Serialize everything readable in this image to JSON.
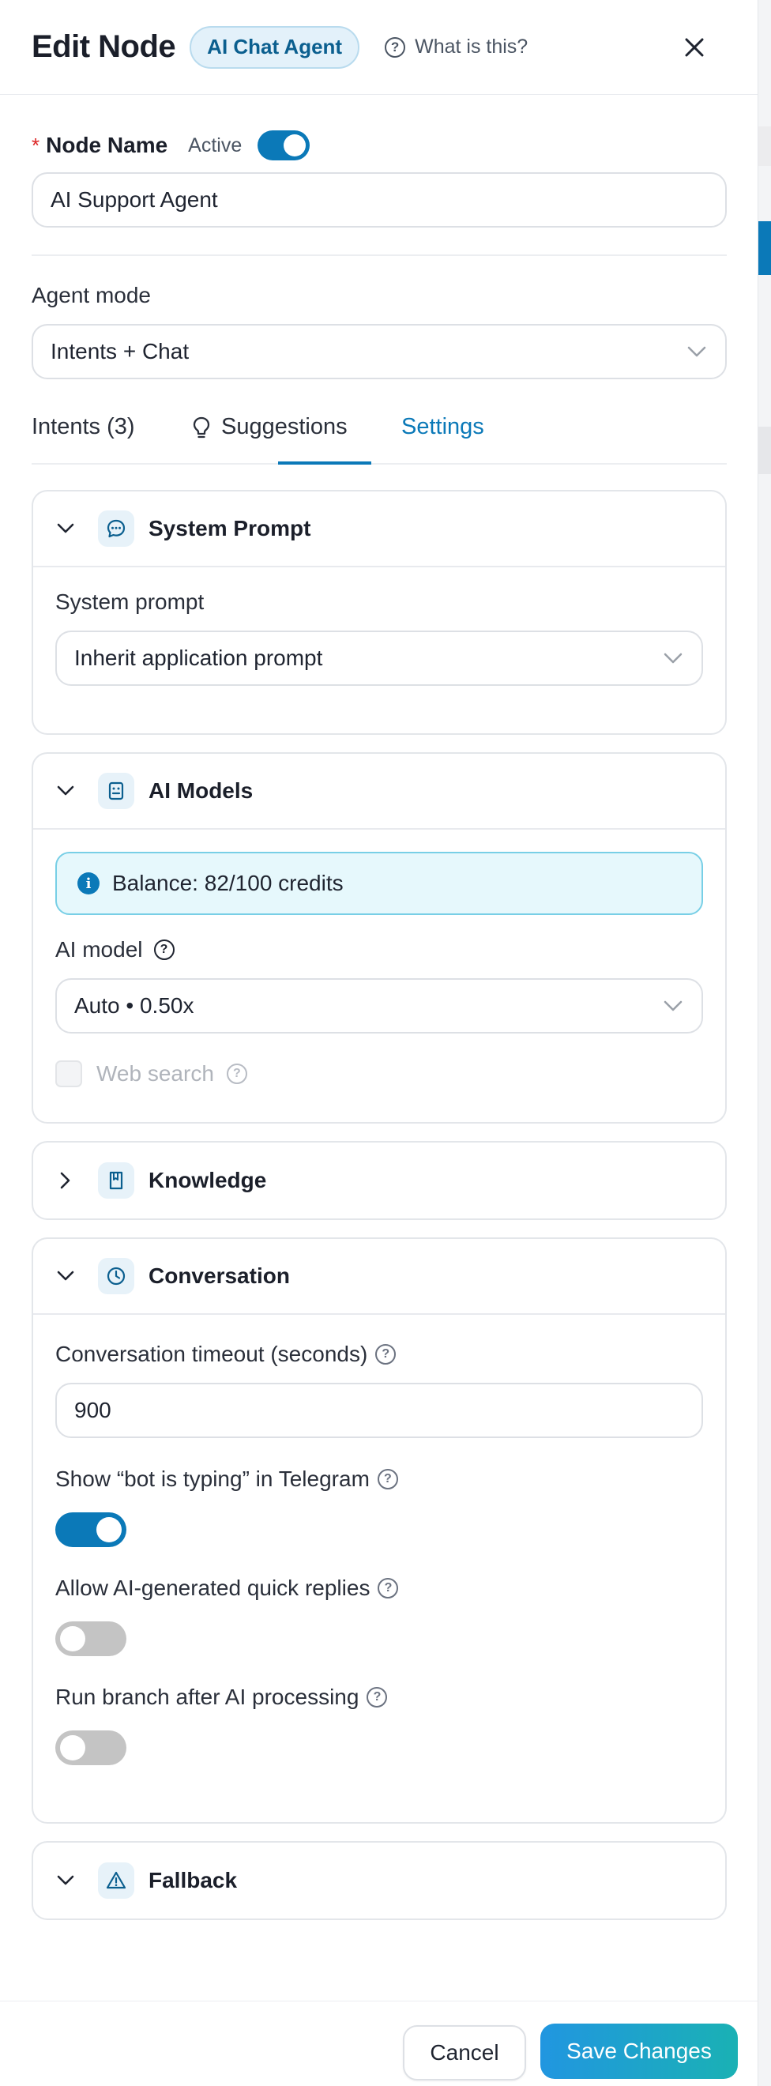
{
  "header": {
    "title": "Edit Node",
    "badge": "AI Chat Agent",
    "help_link": "What is this?"
  },
  "node_name": {
    "label": "Node Name",
    "required_mark": "*",
    "active_label": "Active",
    "active": true,
    "value": "AI Support Agent"
  },
  "agent_mode": {
    "label": "Agent mode",
    "value": "Intents + Chat"
  },
  "tabs": [
    {
      "label": "Intents (3)"
    },
    {
      "label": "Suggestions"
    },
    {
      "label": "Settings",
      "active": true
    }
  ],
  "system_prompt": {
    "title": "System Prompt",
    "field_label": "System prompt",
    "value": "Inherit application prompt"
  },
  "ai_models": {
    "title": "AI Models",
    "balance": "Balance: 82/100 credits",
    "model_label": "AI model",
    "model_value": "Auto • 0.50x",
    "web_search_label": "Web search",
    "web_search_checked": false
  },
  "knowledge": {
    "title": "Knowledge"
  },
  "conversation": {
    "title": "Conversation",
    "timeout_label": "Conversation timeout (seconds)",
    "timeout_value": "900",
    "typing_label": "Show “bot is typing” in Telegram",
    "typing_on": true,
    "quick_replies_label": "Allow AI-generated quick replies",
    "quick_replies_on": false,
    "run_branch_label": "Run branch after AI processing",
    "run_branch_on": false
  },
  "fallback": {
    "title": "Fallback"
  },
  "footer": {
    "cancel": "Cancel",
    "save": "Save Changes"
  },
  "colors": {
    "accent": "#0b79b8",
    "save_gradient_start": "#2196e0",
    "save_gradient_end": "#1ab1b4",
    "info_border": "#78cfe6",
    "info_bg": "#e6f8fc"
  }
}
